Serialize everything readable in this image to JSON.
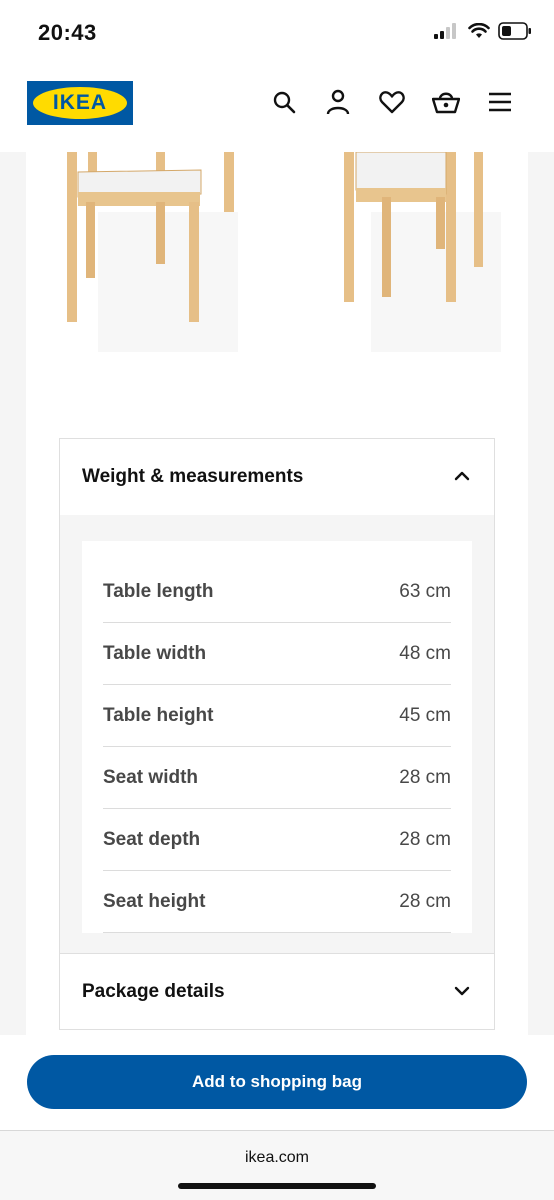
{
  "status": {
    "time": "20:43"
  },
  "header": {
    "logo_text": "IKEA",
    "icons": [
      "search-icon",
      "account-icon",
      "heart-icon",
      "basket-icon",
      "menu-icon"
    ]
  },
  "colors": {
    "brand_blue": "#0058a3",
    "brand_yellow": "#ffdb00",
    "wood": "#e6bf87",
    "panel_bg": "#f5f5f5"
  },
  "measurements": {
    "title": "Weight & measurements",
    "rows": [
      {
        "label": "Table length",
        "value": "63 cm"
      },
      {
        "label": "Table width",
        "value": "48 cm"
      },
      {
        "label": "Table height",
        "value": "45 cm"
      },
      {
        "label": "Seat width",
        "value": "28 cm"
      },
      {
        "label": "Seat depth",
        "value": "28 cm"
      },
      {
        "label": "Seat height",
        "value": "28 cm"
      }
    ]
  },
  "package": {
    "title": "Package details"
  },
  "cta": {
    "label": "Add to shopping bag"
  },
  "browser": {
    "url": "ikea.com"
  }
}
